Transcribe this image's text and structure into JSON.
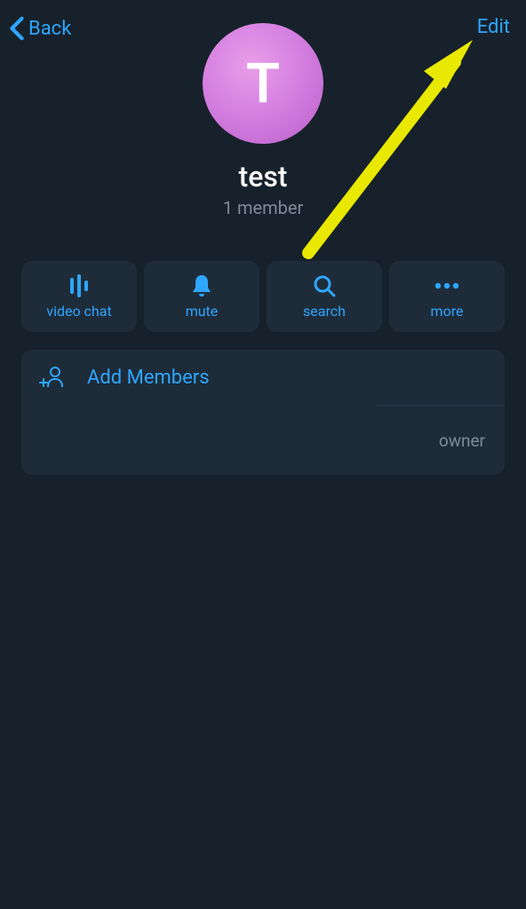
{
  "header": {
    "back_label": "Back",
    "edit_label": "Edit"
  },
  "profile": {
    "avatar_letter": "T",
    "group_name": "test",
    "member_count": "1 member"
  },
  "actions": {
    "video_chat": "video chat",
    "mute": "mute",
    "search": "search",
    "more": "more"
  },
  "members": {
    "add_label": "Add Members",
    "role_label": "owner"
  },
  "colors": {
    "accent": "#2ea6ff",
    "background": "#17212b",
    "card": "#1e2c3a",
    "muted": "#7d8b99"
  }
}
